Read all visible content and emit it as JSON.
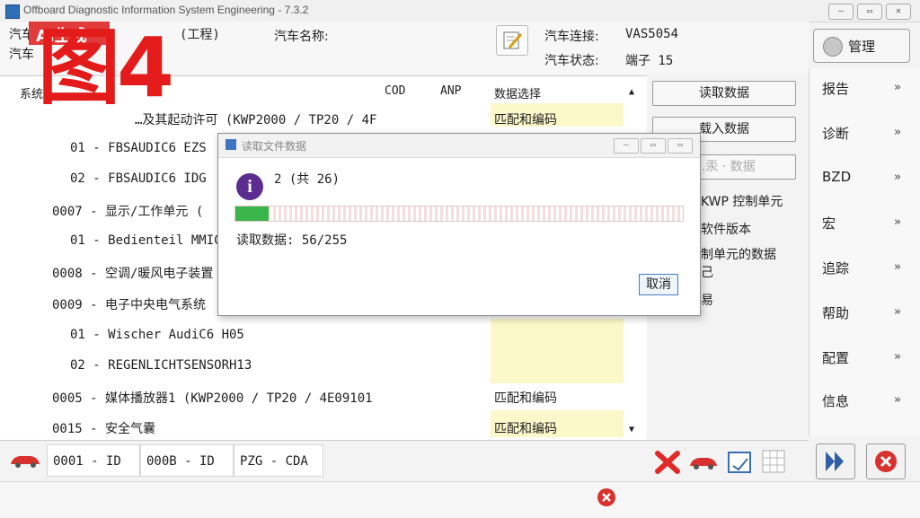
{
  "window": {
    "title": "Offboard Diagnostic Information System Engineering - 7.3.2",
    "controls": [
      "minimize",
      "restore",
      "close"
    ]
  },
  "watermark": {
    "tag": "AI生成",
    "big": "图4"
  },
  "header": {
    "vehicle_label_1": "汽车",
    "vehicle_label_2": "汽车",
    "project": "(工程)",
    "vehicle_name_label": "汽车名称:",
    "connection_label": "汽车连接:",
    "connection_value": "VAS5054",
    "status_label": "汽车状态:",
    "status_value": "端子 15",
    "admin_label": "管理"
  },
  "table": {
    "system_header": "系统",
    "col_cod": "COD",
    "col_anp": "ANP",
    "col_data_select": "数据选择",
    "rows": [
      {
        "text": "…及其起动许可  (KWP2000 / TP20 / 4F",
        "data": "匹配和编码"
      },
      {
        "text": "01 - FBSAUDIC6 EZS",
        "data": ""
      },
      {
        "text": "02 - FBSAUDIC6 IDG",
        "data": ""
      },
      {
        "text": "0007 - 显示/工作单元  (",
        "data": ""
      },
      {
        "text": "01 - Bedienteil MMIC6",
        "data": ""
      },
      {
        "text": "0008 - 空调/暖风电子装置",
        "data": ""
      },
      {
        "text": "0009 - 电子中央电气系统",
        "data": ""
      },
      {
        "text": "01 - Wischer AudiC6  H05",
        "data": ""
      },
      {
        "text": "02 - REGENLICHTSENSORH13",
        "data": ""
      },
      {
        "text": "0005 - 媒体播放器1  (KWP2000 / TP20 / 4E09101",
        "data": "匹配和编码"
      },
      {
        "text": "0015 - 安全气囊",
        "data": "匹配和编码"
      }
    ]
  },
  "actions": {
    "read_data": "读取数据",
    "load_data": "载入数据",
    "placeholder_btn": "…汞 · 数据",
    "side_1": "KWP 控制单元",
    "side_2": "软件版本",
    "side_3": "制单元的数据",
    "side_4": "己",
    "side_5": "易"
  },
  "nav": [
    {
      "label": "报告"
    },
    {
      "label": "诊断"
    },
    {
      "label": "BZD"
    },
    {
      "label": "宏"
    },
    {
      "label": "追踪"
    },
    {
      "label": "帮助"
    },
    {
      "label": "配置"
    },
    {
      "label": "信息"
    }
  ],
  "bottom_tabs": [
    "0001 - ID",
    "000B - ID",
    "PZG - CDA"
  ],
  "dialog": {
    "title": "读取文件数据",
    "count": "2 (共 26)",
    "progress_text": "读取数据: 56/255",
    "progress_fraction": 0.075,
    "cancel": "取消"
  },
  "colors": {
    "accent": "#2e6fb5",
    "progress": "#39b54a",
    "highlight": "#fbf8c9",
    "watermark": "#e31b1b",
    "close_red": "#d9312f"
  }
}
